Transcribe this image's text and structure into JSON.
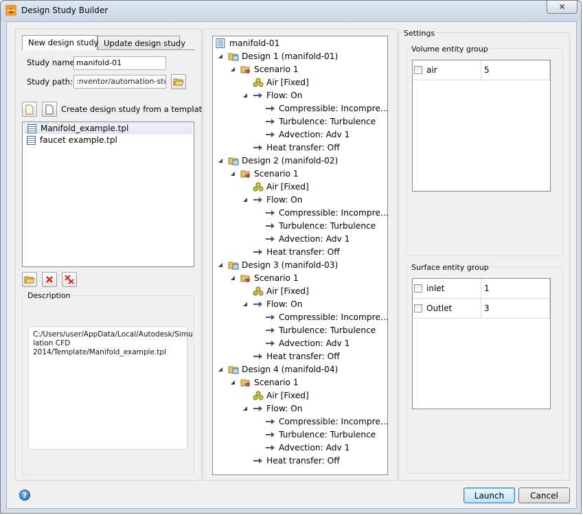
{
  "window": {
    "title": "Design Study Builder",
    "close_symbol": "✕"
  },
  "tabs": [
    "New design study",
    "Update design study"
  ],
  "study": {
    "name_label": "Study name:",
    "name_value": "manifold-01",
    "path_label": "Study path:",
    "path_value": ":nventor/automation-study"
  },
  "template": {
    "create_label": "Create design study from a template file",
    "files": [
      "Manifold_example.tpl",
      "faucet example.tpl"
    ],
    "selected_index": 0
  },
  "description": {
    "label": "Description",
    "text_lines": [
      "C:/Users/user/AppData/Local/Autodesk/Simu",
      "lation CFD",
      "2014/Template/Manifold_example.tpl"
    ]
  },
  "tree": {
    "root": "manifold-01",
    "designs": [
      {
        "label": "Design 1 (manifold-01)",
        "scenario": "Scenario 1",
        "material": "Air [Fixed]",
        "flow": "Flow: On",
        "flow_items": [
          "Compressible: Incompre...",
          "Turbulence: Turbulence",
          "Advection: Adv 1"
        ],
        "heat": "Heat transfer: Off"
      },
      {
        "label": "Design 2 (manifold-02)",
        "scenario": "Scenario 1",
        "material": "Air [Fixed]",
        "flow": "Flow: On",
        "flow_items": [
          "Compressible: Incompre...",
          "Turbulence: Turbulence",
          "Advection: Adv 1"
        ],
        "heat": "Heat transfer: Off"
      },
      {
        "label": "Design 3 (manifold-03)",
        "scenario": "Scenario 1",
        "material": "Air [Fixed]",
        "flow": "Flow: On",
        "flow_items": [
          "Compressible: Incompre...",
          "Turbulence: Turbulence",
          "Advection: Adv 1"
        ],
        "heat": "Heat transfer: Off"
      },
      {
        "label": "Design 4 (manifold-04)",
        "scenario": "Scenario 1",
        "material": "Air [Fixed]",
        "flow": "Flow: On",
        "flow_items": [
          "Compressible: Incompre...",
          "Turbulence: Turbulence",
          "Advection: Adv 1"
        ],
        "heat": "Heat transfer: Off"
      }
    ]
  },
  "settings": {
    "label": "Settings",
    "volume_group_label": "Volume entity group",
    "volume_rows": [
      {
        "name": "air",
        "value": "5",
        "checked": false
      }
    ],
    "surface_group_label": "Surface entity group",
    "surface_rows": [
      {
        "name": "inlet",
        "value": "1",
        "checked": false
      },
      {
        "name": "Outlet",
        "value": "3",
        "checked": false
      }
    ]
  },
  "buttons": {
    "launch": "Launch",
    "cancel": "Cancel",
    "help": "?"
  },
  "colors": {
    "accent": "#3c7fb1",
    "window_frame": "#d4dde9",
    "panel": "#f0f0f0"
  }
}
